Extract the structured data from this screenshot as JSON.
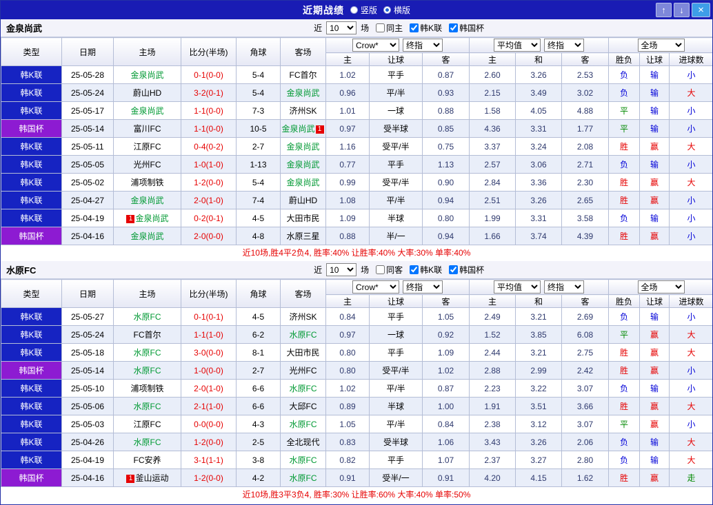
{
  "titlebar": {
    "title": "近期战绩",
    "radios": [
      {
        "label": "竖版",
        "checked": false
      },
      {
        "label": "横版",
        "checked": true
      }
    ],
    "up_icon": "↑",
    "down_icon": "↓",
    "close_icon": "×"
  },
  "table_header": {
    "cols": [
      "类型",
      "日期",
      "主场",
      "比分(半场)",
      "角球",
      "客场"
    ],
    "handicap_group": {
      "select1": "Crow*",
      "select2": "终指",
      "cols": [
        "主",
        "让球",
        "客"
      ]
    },
    "europe_group": {
      "select1": "平均值",
      "select2": "终指",
      "cols": [
        "主",
        "和",
        "客"
      ]
    },
    "result_group": {
      "select1": "全场",
      "cols": [
        "胜负",
        "让球",
        "进球数"
      ]
    }
  },
  "result_colors": {
    "胜": "w",
    "赢": "w",
    "大": "w",
    "平": "d",
    "走": "d",
    "负": "l",
    "输": "l",
    "小": "l"
  },
  "colors": {
    "titlebar_bg": "#191cb4",
    "kleague_bg": "#1623c2",
    "cup_bg": "#8d1bd2",
    "focus_team": "#009933",
    "score": "#e60000",
    "win": "#e60000",
    "draw": "#008800",
    "loss": "#0000d8"
  },
  "sections": [
    {
      "team": "金泉尚武",
      "filters": {
        "near": "近",
        "count": "10",
        "matches": "场",
        "checkboxes": [
          {
            "label": "同主",
            "checked": false
          },
          {
            "label": "韩K联",
            "checked": true
          },
          {
            "label": "韩国杯",
            "checked": true
          }
        ]
      },
      "rows": [
        {
          "type": "韩K联",
          "date": "25-05-28",
          "home": "金泉尚武",
          "home_focus": true,
          "score": "0-1(0-0)",
          "corners": "5-4",
          "away": "FC首尔",
          "away_focus": false,
          "odds": [
            "1.02",
            "平手",
            "0.87"
          ],
          "avg": [
            "2.60",
            "3.26",
            "2.53"
          ],
          "results": [
            "负",
            "输",
            "小"
          ]
        },
        {
          "type": "韩K联",
          "date": "25-05-24",
          "home": "蔚山HD",
          "home_focus": false,
          "score": "3-2(0-1)",
          "corners": "5-4",
          "away": "金泉尚武",
          "away_focus": true,
          "odds": [
            "0.96",
            "平/半",
            "0.93"
          ],
          "avg": [
            "2.15",
            "3.49",
            "3.02"
          ],
          "results": [
            "负",
            "输",
            "大"
          ]
        },
        {
          "type": "韩K联",
          "date": "25-05-17",
          "home": "金泉尚武",
          "home_focus": true,
          "score": "1-1(0-0)",
          "corners": "7-3",
          "away": "济州SK",
          "away_focus": false,
          "odds": [
            "1.01",
            "一球",
            "0.88"
          ],
          "avg": [
            "1.58",
            "4.05",
            "4.88"
          ],
          "results": [
            "平",
            "输",
            "小"
          ]
        },
        {
          "type": "韩国杯",
          "date": "25-05-14",
          "home": "富川FC",
          "home_focus": false,
          "score": "1-1(0-0)",
          "corners": "10-5",
          "away": "金泉尚武",
          "away_focus": true,
          "away_badge": "1",
          "away_badge_pos": "after",
          "odds": [
            "0.97",
            "受半球",
            "0.85"
          ],
          "avg": [
            "4.36",
            "3.31",
            "1.77"
          ],
          "results": [
            "平",
            "输",
            "小"
          ]
        },
        {
          "type": "韩K联",
          "date": "25-05-11",
          "home": "江原FC",
          "home_focus": false,
          "score": "0-4(0-2)",
          "corners": "2-7",
          "away": "金泉尚武",
          "away_focus": true,
          "odds": [
            "1.16",
            "受平/半",
            "0.75"
          ],
          "avg": [
            "3.37",
            "3.24",
            "2.08"
          ],
          "results": [
            "胜",
            "赢",
            "大"
          ]
        },
        {
          "type": "韩K联",
          "date": "25-05-05",
          "home": "光州FC",
          "home_focus": false,
          "score": "1-0(1-0)",
          "corners": "1-13",
          "away": "金泉尚武",
          "away_focus": true,
          "odds": [
            "0.77",
            "平手",
            "1.13"
          ],
          "avg": [
            "2.57",
            "3.06",
            "2.71"
          ],
          "results": [
            "负",
            "输",
            "小"
          ]
        },
        {
          "type": "韩K联",
          "date": "25-05-02",
          "home": "浦项制铁",
          "home_focus": false,
          "score": "1-2(0-0)",
          "corners": "5-4",
          "away": "金泉尚武",
          "away_focus": true,
          "odds": [
            "0.99",
            "受平/半",
            "0.90"
          ],
          "avg": [
            "2.84",
            "3.36",
            "2.30"
          ],
          "results": [
            "胜",
            "赢",
            "大"
          ]
        },
        {
          "type": "韩K联",
          "date": "25-04-27",
          "home": "金泉尚武",
          "home_focus": true,
          "score": "2-0(1-0)",
          "corners": "7-4",
          "away": "蔚山HD",
          "away_focus": false,
          "odds": [
            "1.08",
            "平/半",
            "0.94"
          ],
          "avg": [
            "2.51",
            "3.26",
            "2.65"
          ],
          "results": [
            "胜",
            "赢",
            "小"
          ]
        },
        {
          "type": "韩K联",
          "date": "25-04-19",
          "home": "金泉尚武",
          "home_focus": true,
          "home_badge": "1",
          "home_badge_pos": "before",
          "score": "0-2(0-1)",
          "corners": "4-5",
          "away": "大田市民",
          "away_focus": false,
          "odds": [
            "1.09",
            "半球",
            "0.80"
          ],
          "avg": [
            "1.99",
            "3.31",
            "3.58"
          ],
          "results": [
            "负",
            "输",
            "小"
          ]
        },
        {
          "type": "韩国杯",
          "date": "25-04-16",
          "home": "金泉尚武",
          "home_focus": true,
          "score": "2-0(0-0)",
          "corners": "4-8",
          "away": "水原三星",
          "away_focus": false,
          "odds": [
            "0.88",
            "半/一",
            "0.94"
          ],
          "avg": [
            "1.66",
            "3.74",
            "4.39"
          ],
          "results": [
            "胜",
            "赢",
            "小"
          ]
        }
      ],
      "summary": "近10场,胜4平2负4, 胜率:40% 让胜率:40% 大率:30% 单率:40%"
    },
    {
      "team": "水原FC",
      "filters": {
        "near": "近",
        "count": "10",
        "matches": "场",
        "checkboxes": [
          {
            "label": "同客",
            "checked": false
          },
          {
            "label": "韩K联",
            "checked": true
          },
          {
            "label": "韩国杯",
            "checked": true
          }
        ]
      },
      "rows": [
        {
          "type": "韩K联",
          "date": "25-05-27",
          "home": "水原FC",
          "home_focus": true,
          "score": "0-1(0-1)",
          "corners": "4-5",
          "away": "济州SK",
          "away_focus": false,
          "odds": [
            "0.84",
            "平手",
            "1.05"
          ],
          "avg": [
            "2.49",
            "3.21",
            "2.69"
          ],
          "results": [
            "负",
            "输",
            "小"
          ]
        },
        {
          "type": "韩K联",
          "date": "25-05-24",
          "home": "FC首尔",
          "home_focus": false,
          "score": "1-1(1-0)",
          "corners": "6-2",
          "away": "水原FC",
          "away_focus": true,
          "odds": [
            "0.97",
            "一球",
            "0.92"
          ],
          "avg": [
            "1.52",
            "3.85",
            "6.08"
          ],
          "results": [
            "平",
            "赢",
            "大"
          ]
        },
        {
          "type": "韩K联",
          "date": "25-05-18",
          "home": "水原FC",
          "home_focus": true,
          "score": "3-0(0-0)",
          "corners": "8-1",
          "away": "大田市民",
          "away_focus": false,
          "odds": [
            "0.80",
            "平手",
            "1.09"
          ],
          "avg": [
            "2.44",
            "3.21",
            "2.75"
          ],
          "results": [
            "胜",
            "赢",
            "大"
          ]
        },
        {
          "type": "韩国杯",
          "date": "25-05-14",
          "home": "水原FC",
          "home_focus": true,
          "score": "1-0(0-0)",
          "corners": "2-7",
          "away": "光州FC",
          "away_focus": false,
          "odds": [
            "0.80",
            "受平/半",
            "1.02"
          ],
          "avg": [
            "2.88",
            "2.99",
            "2.42"
          ],
          "results": [
            "胜",
            "赢",
            "小"
          ]
        },
        {
          "type": "韩K联",
          "date": "25-05-10",
          "home": "浦项制铁",
          "home_focus": false,
          "score": "2-0(1-0)",
          "corners": "6-6",
          "away": "水原FC",
          "away_focus": true,
          "odds": [
            "1.02",
            "平/半",
            "0.87"
          ],
          "avg": [
            "2.23",
            "3.22",
            "3.07"
          ],
          "results": [
            "负",
            "输",
            "小"
          ]
        },
        {
          "type": "韩K联",
          "date": "25-05-06",
          "home": "水原FC",
          "home_focus": true,
          "score": "2-1(1-0)",
          "corners": "6-6",
          "away": "大邱FC",
          "away_focus": false,
          "odds": [
            "0.89",
            "半球",
            "1.00"
          ],
          "avg": [
            "1.91",
            "3.51",
            "3.66"
          ],
          "results": [
            "胜",
            "赢",
            "大"
          ]
        },
        {
          "type": "韩K联",
          "date": "25-05-03",
          "home": "江原FC",
          "home_focus": false,
          "score": "0-0(0-0)",
          "corners": "4-3",
          "away": "水原FC",
          "away_focus": true,
          "odds": [
            "1.05",
            "平/半",
            "0.84"
          ],
          "avg": [
            "2.38",
            "3.12",
            "3.07"
          ],
          "results": [
            "平",
            "赢",
            "小"
          ]
        },
        {
          "type": "韩K联",
          "date": "25-04-26",
          "home": "水原FC",
          "home_focus": true,
          "score": "1-2(0-0)",
          "corners": "2-5",
          "away": "全北现代",
          "away_focus": false,
          "odds": [
            "0.83",
            "受半球",
            "1.06"
          ],
          "avg": [
            "3.43",
            "3.26",
            "2.06"
          ],
          "results": [
            "负",
            "输",
            "大"
          ]
        },
        {
          "type": "韩K联",
          "date": "25-04-19",
          "home": "FC安养",
          "home_focus": false,
          "score": "3-1(1-1)",
          "corners": "3-8",
          "away": "水原FC",
          "away_focus": true,
          "odds": [
            "0.82",
            "平手",
            "1.07"
          ],
          "avg": [
            "2.37",
            "3.27",
            "2.80"
          ],
          "results": [
            "负",
            "输",
            "大"
          ]
        },
        {
          "type": "韩国杯",
          "date": "25-04-16",
          "home": "釜山运动",
          "home_focus": false,
          "home_badge": "1",
          "home_badge_pos": "before",
          "score": "1-2(0-0)",
          "corners": "4-2",
          "away": "水原FC",
          "away_focus": true,
          "odds": [
            "0.91",
            "受半/一",
            "0.91"
          ],
          "avg": [
            "4.20",
            "4.15",
            "1.62"
          ],
          "results": [
            "胜",
            "赢",
            "走"
          ]
        }
      ],
      "summary": "近10场,胜3平3负4, 胜率:30% 让胜率:60% 大率:40% 单率:50%"
    }
  ]
}
